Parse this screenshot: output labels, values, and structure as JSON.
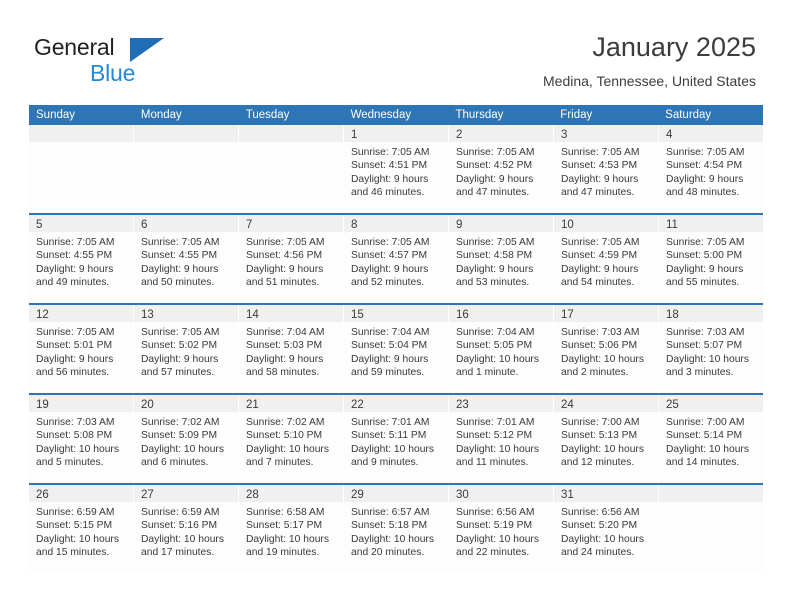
{
  "brand": {
    "name_part1": "General",
    "name_part2": "Blue",
    "triangle_icon": "triangle-logo-icon",
    "colors": {
      "dark": "#231f20",
      "blue": "#2389d6",
      "triangle": "#1f6eb5"
    }
  },
  "header": {
    "title": "January 2025",
    "subtitle": "Medina, Tennessee, United States"
  },
  "theme": {
    "header_bar": "#2e75b6",
    "day_strip": "#f0f0f0",
    "cell_bg": "#fdfdfd",
    "text": "#3a3a3a"
  },
  "weekdays": [
    "Sunday",
    "Monday",
    "Tuesday",
    "Wednesday",
    "Thursday",
    "Friday",
    "Saturday"
  ],
  "weeks": [
    [
      {
        "day": "",
        "lines": []
      },
      {
        "day": "",
        "lines": []
      },
      {
        "day": "",
        "lines": []
      },
      {
        "day": "1",
        "lines": [
          "Sunrise: 7:05 AM",
          "Sunset: 4:51 PM",
          "Daylight: 9 hours",
          "and 46 minutes."
        ]
      },
      {
        "day": "2",
        "lines": [
          "Sunrise: 7:05 AM",
          "Sunset: 4:52 PM",
          "Daylight: 9 hours",
          "and 47 minutes."
        ]
      },
      {
        "day": "3",
        "lines": [
          "Sunrise: 7:05 AM",
          "Sunset: 4:53 PM",
          "Daylight: 9 hours",
          "and 47 minutes."
        ]
      },
      {
        "day": "4",
        "lines": [
          "Sunrise: 7:05 AM",
          "Sunset: 4:54 PM",
          "Daylight: 9 hours",
          "and 48 minutes."
        ]
      }
    ],
    [
      {
        "day": "5",
        "lines": [
          "Sunrise: 7:05 AM",
          "Sunset: 4:55 PM",
          "Daylight: 9 hours",
          "and 49 minutes."
        ]
      },
      {
        "day": "6",
        "lines": [
          "Sunrise: 7:05 AM",
          "Sunset: 4:55 PM",
          "Daylight: 9 hours",
          "and 50 minutes."
        ]
      },
      {
        "day": "7",
        "lines": [
          "Sunrise: 7:05 AM",
          "Sunset: 4:56 PM",
          "Daylight: 9 hours",
          "and 51 minutes."
        ]
      },
      {
        "day": "8",
        "lines": [
          "Sunrise: 7:05 AM",
          "Sunset: 4:57 PM",
          "Daylight: 9 hours",
          "and 52 minutes."
        ]
      },
      {
        "day": "9",
        "lines": [
          "Sunrise: 7:05 AM",
          "Sunset: 4:58 PM",
          "Daylight: 9 hours",
          "and 53 minutes."
        ]
      },
      {
        "day": "10",
        "lines": [
          "Sunrise: 7:05 AM",
          "Sunset: 4:59 PM",
          "Daylight: 9 hours",
          "and 54 minutes."
        ]
      },
      {
        "day": "11",
        "lines": [
          "Sunrise: 7:05 AM",
          "Sunset: 5:00 PM",
          "Daylight: 9 hours",
          "and 55 minutes."
        ]
      }
    ],
    [
      {
        "day": "12",
        "lines": [
          "Sunrise: 7:05 AM",
          "Sunset: 5:01 PM",
          "Daylight: 9 hours",
          "and 56 minutes."
        ]
      },
      {
        "day": "13",
        "lines": [
          "Sunrise: 7:05 AM",
          "Sunset: 5:02 PM",
          "Daylight: 9 hours",
          "and 57 minutes."
        ]
      },
      {
        "day": "14",
        "lines": [
          "Sunrise: 7:04 AM",
          "Sunset: 5:03 PM",
          "Daylight: 9 hours",
          "and 58 minutes."
        ]
      },
      {
        "day": "15",
        "lines": [
          "Sunrise: 7:04 AM",
          "Sunset: 5:04 PM",
          "Daylight: 9 hours",
          "and 59 minutes."
        ]
      },
      {
        "day": "16",
        "lines": [
          "Sunrise: 7:04 AM",
          "Sunset: 5:05 PM",
          "Daylight: 10 hours",
          "and 1 minute."
        ]
      },
      {
        "day": "17",
        "lines": [
          "Sunrise: 7:03 AM",
          "Sunset: 5:06 PM",
          "Daylight: 10 hours",
          "and 2 minutes."
        ]
      },
      {
        "day": "18",
        "lines": [
          "Sunrise: 7:03 AM",
          "Sunset: 5:07 PM",
          "Daylight: 10 hours",
          "and 3 minutes."
        ]
      }
    ],
    [
      {
        "day": "19",
        "lines": [
          "Sunrise: 7:03 AM",
          "Sunset: 5:08 PM",
          "Daylight: 10 hours",
          "and 5 minutes."
        ]
      },
      {
        "day": "20",
        "lines": [
          "Sunrise: 7:02 AM",
          "Sunset: 5:09 PM",
          "Daylight: 10 hours",
          "and 6 minutes."
        ]
      },
      {
        "day": "21",
        "lines": [
          "Sunrise: 7:02 AM",
          "Sunset: 5:10 PM",
          "Daylight: 10 hours",
          "and 7 minutes."
        ]
      },
      {
        "day": "22",
        "lines": [
          "Sunrise: 7:01 AM",
          "Sunset: 5:11 PM",
          "Daylight: 10 hours",
          "and 9 minutes."
        ]
      },
      {
        "day": "23",
        "lines": [
          "Sunrise: 7:01 AM",
          "Sunset: 5:12 PM",
          "Daylight: 10 hours",
          "and 11 minutes."
        ]
      },
      {
        "day": "24",
        "lines": [
          "Sunrise: 7:00 AM",
          "Sunset: 5:13 PM",
          "Daylight: 10 hours",
          "and 12 minutes."
        ]
      },
      {
        "day": "25",
        "lines": [
          "Sunrise: 7:00 AM",
          "Sunset: 5:14 PM",
          "Daylight: 10 hours",
          "and 14 minutes."
        ]
      }
    ],
    [
      {
        "day": "26",
        "lines": [
          "Sunrise: 6:59 AM",
          "Sunset: 5:15 PM",
          "Daylight: 10 hours",
          "and 15 minutes."
        ]
      },
      {
        "day": "27",
        "lines": [
          "Sunrise: 6:59 AM",
          "Sunset: 5:16 PM",
          "Daylight: 10 hours",
          "and 17 minutes."
        ]
      },
      {
        "day": "28",
        "lines": [
          "Sunrise: 6:58 AM",
          "Sunset: 5:17 PM",
          "Daylight: 10 hours",
          "and 19 minutes."
        ]
      },
      {
        "day": "29",
        "lines": [
          "Sunrise: 6:57 AM",
          "Sunset: 5:18 PM",
          "Daylight: 10 hours",
          "and 20 minutes."
        ]
      },
      {
        "day": "30",
        "lines": [
          "Sunrise: 6:56 AM",
          "Sunset: 5:19 PM",
          "Daylight: 10 hours",
          "and 22 minutes."
        ]
      },
      {
        "day": "31",
        "lines": [
          "Sunrise: 6:56 AM",
          "Sunset: 5:20 PM",
          "Daylight: 10 hours",
          "and 24 minutes."
        ]
      },
      {
        "day": "",
        "lines": []
      }
    ]
  ]
}
